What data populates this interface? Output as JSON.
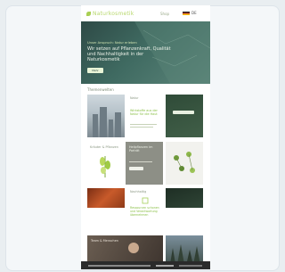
{
  "site": {
    "logo_text": "Naturkosmetik",
    "nav_link": "Shop",
    "lang": "DE"
  },
  "hero": {
    "kicker": "Unser Anspruch: Natur erleben",
    "title": "Wir setzen auf Pflanzenkraft, Qualität und Nachhaltigkeit in der Naturkosmetik",
    "button": "Mehr"
  },
  "section_label": "Themenwelten",
  "tiles": {
    "text1_label": "Natur",
    "text1_head": "Wirkstoffe aus der Natur für die Haut",
    "grey_head": "Heilpflanzen im Porträt",
    "plant_label": "Kräuter & Pflanzen",
    "text2_label": "Nachhaltig",
    "text2_head": "Ressourcen schonen und Verantwortung übernehmen",
    "person_label": "Team & Menschen"
  },
  "colors": {
    "accent": "#8cc04a",
    "hero_bg": "#3f6a61",
    "cookie_bar": "#2b2b2b"
  }
}
